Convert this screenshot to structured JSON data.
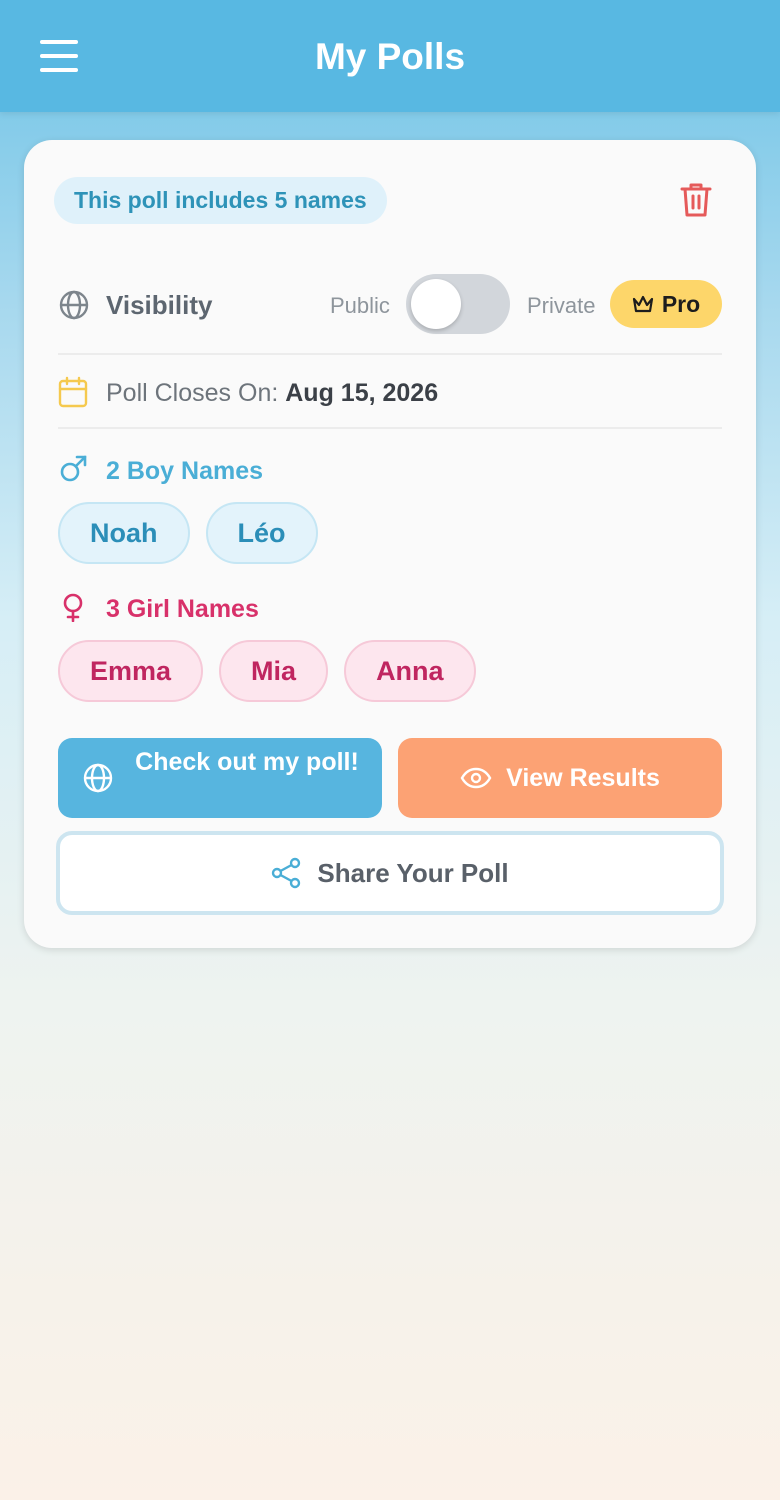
{
  "header": {
    "title": "My Polls",
    "menu_icon": "hamburger-menu-icon"
  },
  "poll": {
    "count_text": "This poll includes 5 names",
    "visibility": {
      "label": "Visibility",
      "public_label": "Public",
      "private_label": "Private",
      "is_private": false,
      "pro_label": "Pro"
    },
    "closes": {
      "label": "Poll Closes On: ",
      "date": "Aug 15, 2026"
    },
    "boys": {
      "heading": "2 Boy Names",
      "names": [
        "Noah",
        "Léo"
      ]
    },
    "girls": {
      "heading": "3 Girl Names",
      "names": [
        "Emma",
        "Mia",
        "Anna"
      ]
    },
    "actions": {
      "check_label": "Check out my poll!",
      "results_label": "View Results",
      "share_label": "Share Your Poll"
    }
  },
  "colors": {
    "primary": "#58b8e2",
    "boy": "#4aaed6",
    "girl": "#d8316a",
    "results": "#fca274",
    "pro": "#fdd66a",
    "delete": "#e55a5a"
  }
}
